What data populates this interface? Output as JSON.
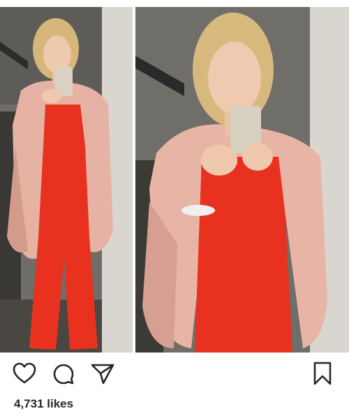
{
  "post": {
    "likes_text": "4,731 likes"
  },
  "actions": {
    "like_icon": "heart-outline-icon",
    "comment_icon": "comment-bubble-icon",
    "share_icon": "paper-plane-icon",
    "save_icon": "bookmark-icon"
  },
  "colors": {
    "icon_stroke": "#262626",
    "likes_text": "#262626",
    "jumpsuit": "#e8321f",
    "cardigan": "#e8b0a0"
  }
}
